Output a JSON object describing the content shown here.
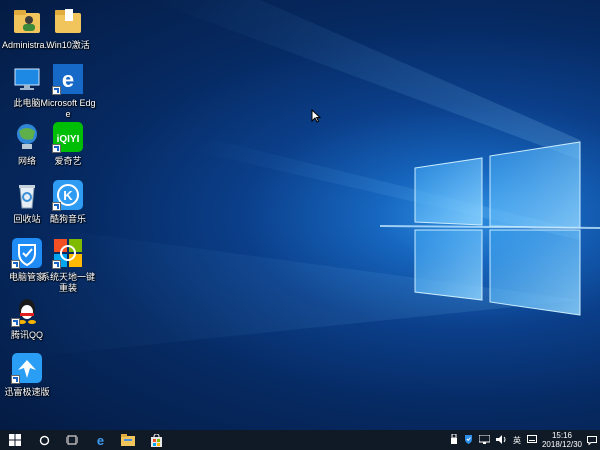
{
  "desktop": {
    "icons": [
      {
        "label": "Administra...",
        "icon": "user-folder-icon"
      },
      {
        "label": "Win10激活",
        "icon": "activation-folder-icon"
      },
      {
        "label": "此电脑",
        "icon": "computer-icon"
      },
      {
        "label": "Microsoft Edge",
        "icon": "edge-icon"
      },
      {
        "label": "网络",
        "icon": "network-icon"
      },
      {
        "label": "爱奇艺",
        "icon": "iqiyi-icon"
      },
      {
        "label": "回收站",
        "icon": "recycle-bin-icon"
      },
      {
        "label": "酷狗音乐",
        "icon": "kugou-icon"
      },
      {
        "label": "电脑管家",
        "icon": "pc-manager-icon"
      },
      {
        "label": "系统天地一键重装",
        "icon": "reinstall-icon"
      },
      {
        "label": "腾讯QQ",
        "icon": "qq-icon"
      },
      {
        "label": "迅雷极速版",
        "icon": "xunlei-icon"
      }
    ]
  },
  "taskbar": {
    "pinned": [
      "start-icon",
      "cortana-icon",
      "task-view-icon",
      "edge-icon",
      "file-explorer-icon",
      "store-icon"
    ],
    "tray": {
      "input_method": "英",
      "time": "15:16",
      "date": "2018/12/30"
    }
  },
  "colors": {
    "taskbar": "#101a26",
    "accent": "#1a64c8",
    "wallpaper_light": "#8fd4ff"
  }
}
